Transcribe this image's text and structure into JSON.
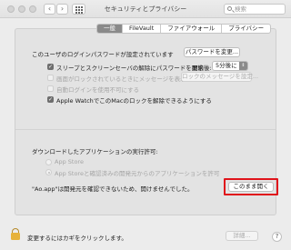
{
  "window": {
    "title": "セキュリティとプライバシー",
    "search_placeholder": "検索"
  },
  "tabs": [
    {
      "label": "一般",
      "active": true
    },
    {
      "label": "FileVault",
      "active": false
    },
    {
      "label": "ファイアウォール",
      "active": false
    },
    {
      "label": "プライバシー",
      "active": false
    }
  ],
  "general": {
    "password_set_text": "このユーザのログインパスワードが設定されています",
    "change_password_button": "パスワードを変更...",
    "require_password": {
      "label": "スリープとスクリーンセーバの解除にパスワードを要求",
      "checked": true,
      "start_label": "開始後:",
      "start_value": "5分後に"
    },
    "lock_message": {
      "label": "画面がロックされているときにメッセージを表示",
      "checked": false,
      "enabled": false,
      "button": "ロックのメッセージを設定..."
    },
    "disable_auto_login": {
      "label": "自動ログインを使用不可にする",
      "checked": false,
      "enabled": false
    },
    "apple_watch_unlock": {
      "label": "Apple WatchでこのMacのロックを解除できるようにする",
      "checked": true
    }
  },
  "downloads": {
    "heading": "ダウンロードしたアプリケーションの実行許可:",
    "options": [
      {
        "label": "App Store",
        "selected": false
      },
      {
        "label": "App Storeと確認済みの開発元からのアプリケーションを許可",
        "selected": true
      }
    ],
    "blocked_message": "\"Ao.app\"は開発元を確認できないため、開けませんでした。",
    "open_anyway_button": "このまま開く"
  },
  "footer": {
    "lock_text": "変更するにはカギをクリックします。",
    "advanced_button": "詳細...",
    "help_label": "?"
  },
  "colors": {
    "highlight": "#e0141b",
    "lock": "#e7b23a"
  }
}
